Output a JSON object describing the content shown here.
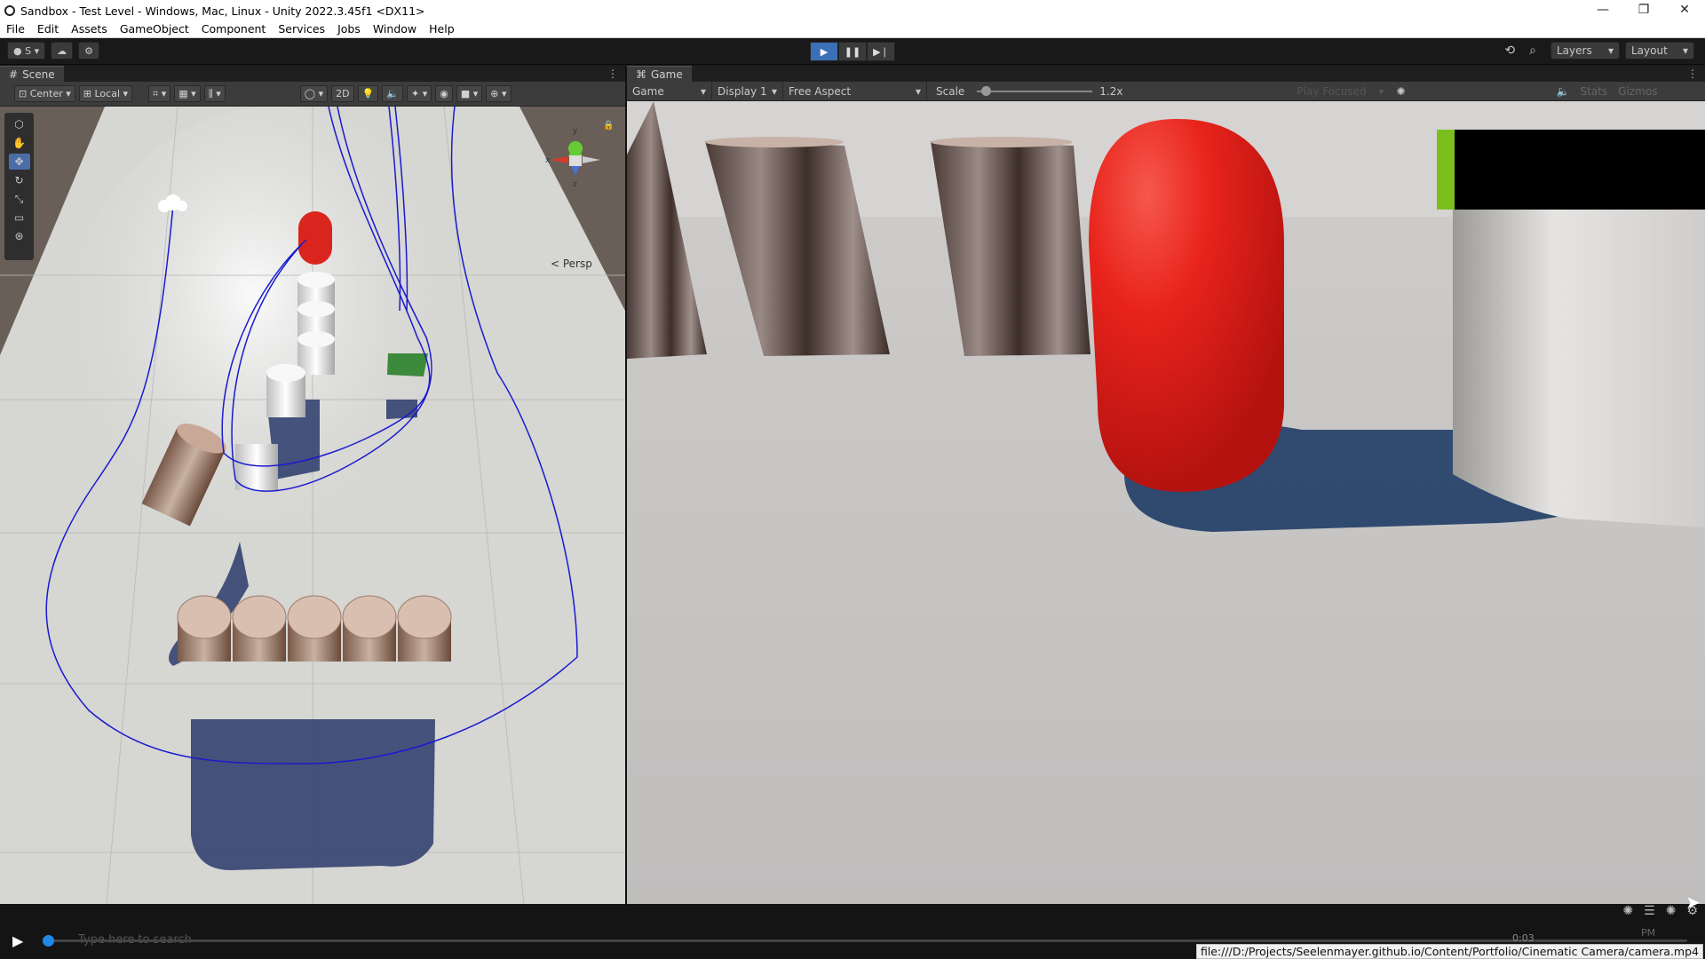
{
  "window": {
    "title": "Sandbox - Test Level - Windows, Mac, Linux - Unity 2022.3.45f1 <DX11>",
    "controls": {
      "minimize": "—",
      "maximize": "❐",
      "close": "✕"
    }
  },
  "menu": [
    "File",
    "Edit",
    "Assets",
    "GameObject",
    "Component",
    "Services",
    "Jobs",
    "Window",
    "Help"
  ],
  "toolbar": {
    "account_label": "S",
    "layers_label": "Layers",
    "layout_label": "Layout"
  },
  "scene": {
    "tab_label": "Scene",
    "pivot_label": "Center",
    "space_label": "Local",
    "mode_2d_label": "2D",
    "persp_label": "< Persp",
    "gizmo_axes": {
      "x": "x",
      "y": "y",
      "z": "z"
    }
  },
  "game": {
    "tab_label": "Game",
    "view_label": "Game",
    "display_label": "Display 1",
    "aspect_label": "Free Aspect",
    "scale_label": "Scale",
    "scale_value": "1.2x",
    "play_mode_label": "Play Focused",
    "stats_label": "Stats",
    "gizmos_label": "Gizmos"
  },
  "video": {
    "search_placeholder": "Type here to search",
    "time_text": "0:03",
    "clock_text": "PM",
    "url": "file:///D:/Projects/Seelenmayer.github.io/Content/Portfolio/Cinematic Camera/camera.mp4"
  },
  "colors": {
    "accent_blue": "#3b6fb6",
    "capsule_red": "#e01d1a",
    "stats_green": "#7bbf1e",
    "progress_blue": "#1e88e5"
  }
}
